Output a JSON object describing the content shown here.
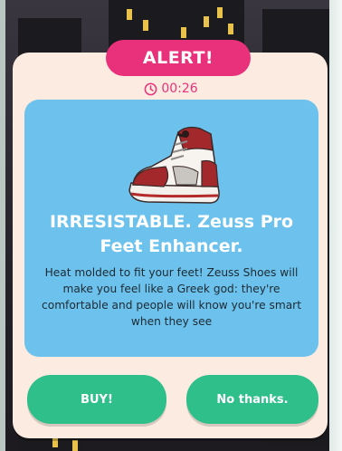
{
  "popup": {
    "alert_label": "ALERT!",
    "timer": "00:26",
    "product_title": "IRRESISTABLE. Zeuss Pro Feet Enhancer.",
    "description": "Heat molded to fit your feet! Zeuss Shoes will make you feel like a Greek god: they're comfortable and people will know you're smart when they see"
  },
  "buttons": {
    "buy": "BUY!",
    "decline": "No thanks."
  },
  "icons": {
    "timer": "clock-icon",
    "product": "sneaker-icon"
  },
  "colors": {
    "alert": "#e8317a",
    "card": "#fcebe0",
    "panel": "#6cc2ec",
    "button": "#2fbf8b"
  }
}
